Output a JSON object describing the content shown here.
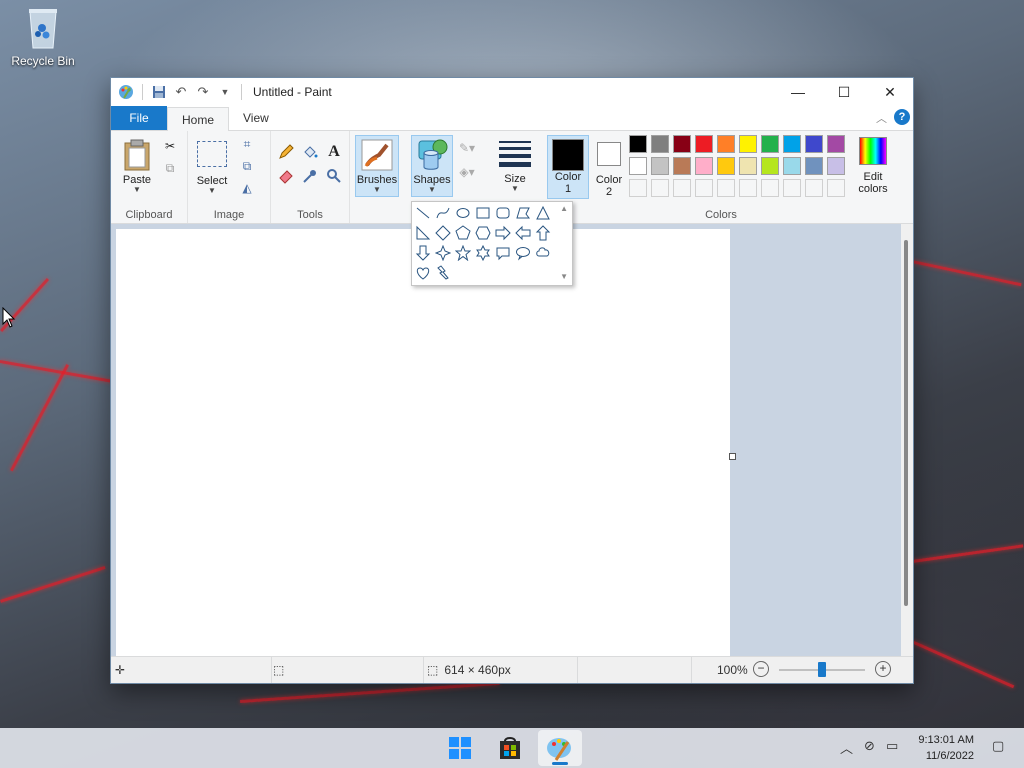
{
  "desktop": {
    "recycle_bin_label": "Recycle Bin"
  },
  "window": {
    "title": "Untitled - Paint",
    "controls": {
      "minimize": "—",
      "maximize": "☐",
      "close": "✕"
    }
  },
  "tabs": {
    "file": "File",
    "home": "Home",
    "view": "View"
  },
  "ribbon": {
    "clipboard": {
      "label": "Clipboard",
      "paste": "Paste"
    },
    "image": {
      "label": "Image",
      "select": "Select"
    },
    "tools": {
      "label": "Tools"
    },
    "brushes": "Brushes",
    "shapes": "Shapes",
    "size": "Size",
    "color1_line1": "Color",
    "color1_line2": "1",
    "color2_line1": "Color",
    "color2_line2": "2",
    "colors": {
      "label": "Colors"
    },
    "edit_colors_line1": "Edit",
    "edit_colors_line2": "colors"
  },
  "palette": {
    "row1": [
      "#000000",
      "#7f7f7f",
      "#880015",
      "#ed1c24",
      "#ff7f27",
      "#fff200",
      "#22b14c",
      "#00a2e8",
      "#3f48cc",
      "#a349a4"
    ],
    "row2": [
      "#ffffff",
      "#c3c3c3",
      "#b97a57",
      "#ffaec9",
      "#ffc90e",
      "#efe4b0",
      "#b5e61d",
      "#99d9ea",
      "#7092be",
      "#c8bfe7"
    ],
    "color1": "#000000",
    "color2": "#ffffff"
  },
  "status": {
    "canvas_size": "614 × 460px",
    "zoom": "100%",
    "zoom_level": 0.5
  },
  "taskbar": {
    "time": "9:13:01 AM",
    "date": "11/6/2022"
  }
}
